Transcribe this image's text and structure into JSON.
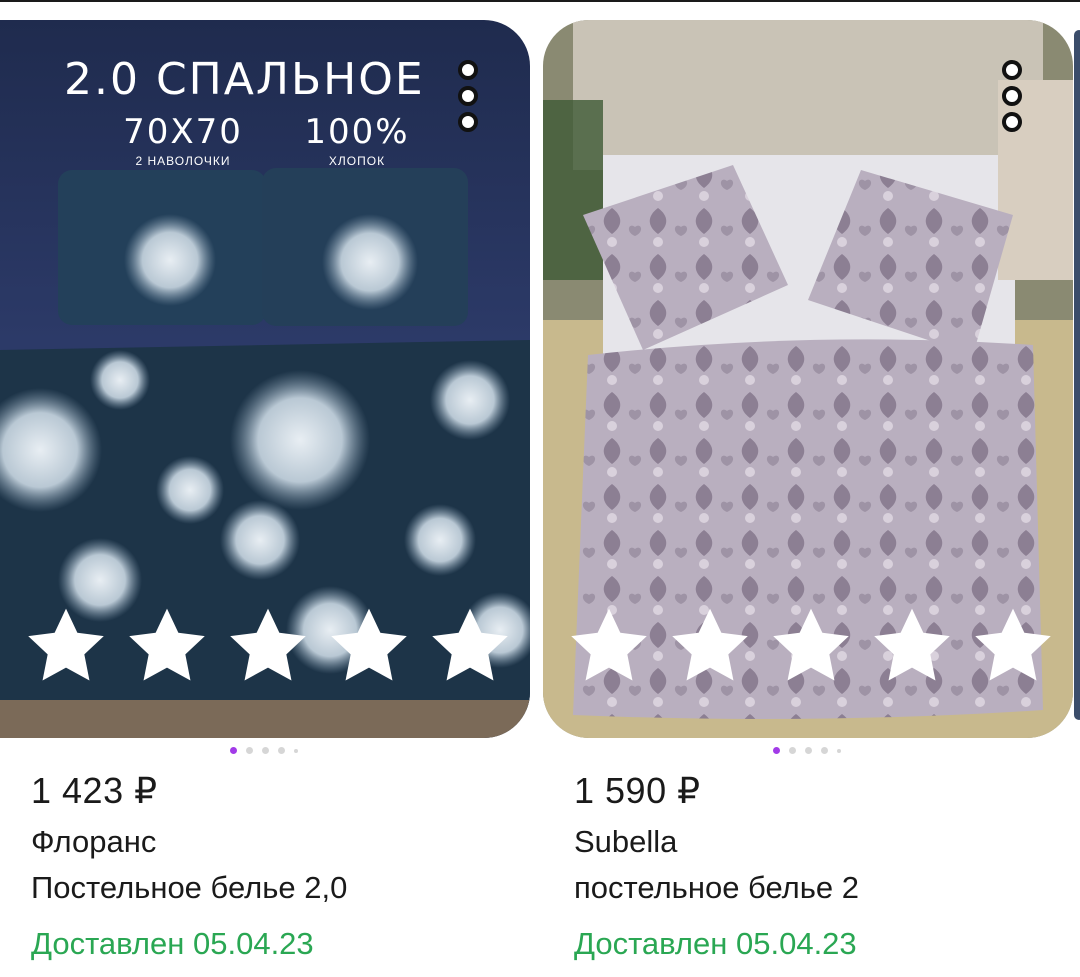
{
  "products": [
    {
      "price": "1 423 ₽",
      "brand": "Флоранс",
      "name": "Постельное белье 2,0",
      "delivery_status": "Доставлен 05.04.23",
      "image_banner": {
        "title": "2.0 СПАЛЬНОЕ",
        "size_value": "70Х70",
        "size_caption": "2 НАВОЛОЧКИ",
        "material_value": "100%",
        "material_caption": "ХЛОПОК"
      },
      "rating_stars": 5,
      "carousel_dots": 5,
      "carousel_active_index": 0
    },
    {
      "price": "1 590 ₽",
      "brand": "Subella",
      "name": "постельное белье 2",
      "delivery_status": "Доставлен 05.04.23",
      "rating_stars": 5,
      "carousel_dots": 5,
      "carousel_active_index": 0
    }
  ],
  "colors": {
    "delivered_green": "#2aa753",
    "carousel_active": "#a23be8",
    "text_primary": "#1a1a1a"
  },
  "icons": {
    "more": "more-vertical-icon",
    "star": "star-icon"
  }
}
